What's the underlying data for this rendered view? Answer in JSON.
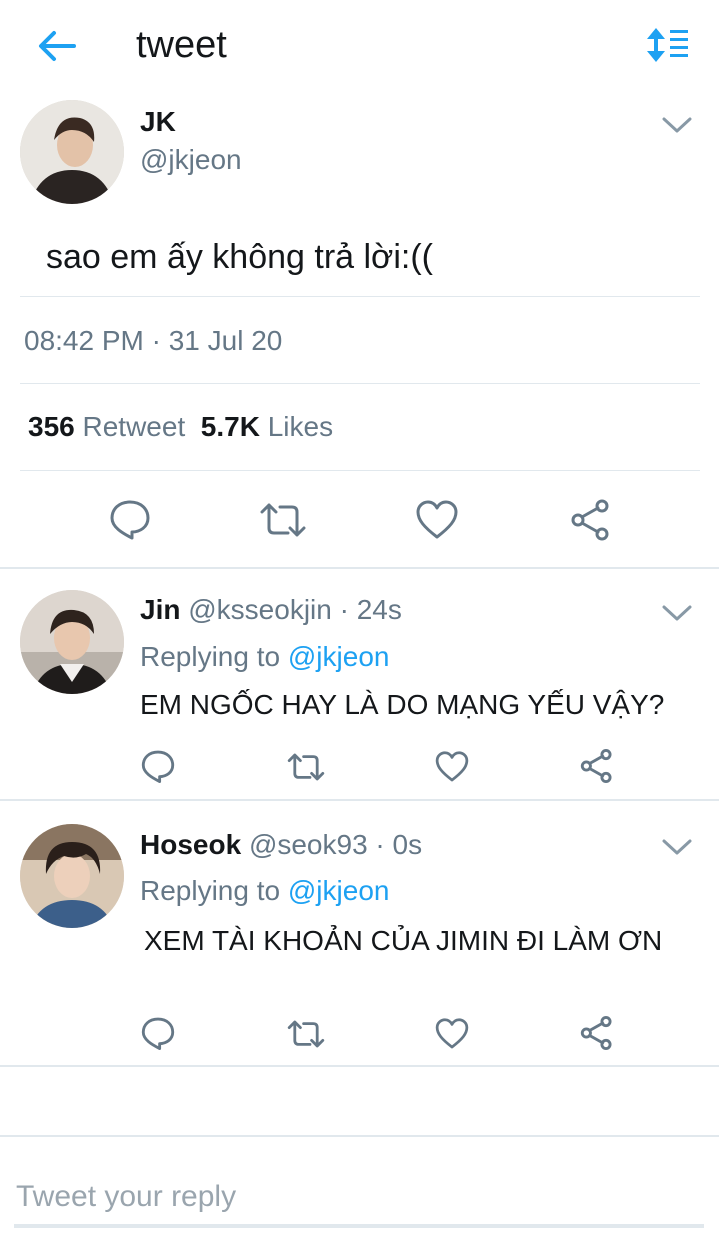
{
  "header": {
    "title": "tweet"
  },
  "tweet": {
    "name": "JK",
    "handle": "@jkjeon",
    "text": "sao em ấy không trả lời:((",
    "timestamp": "08:42 PM · 31 Jul 20",
    "retweet_count": "356",
    "retweet_label": "Retweet",
    "like_count": "5.7K",
    "like_label": "Likes"
  },
  "replies": [
    {
      "name": "Jin",
      "handle_time": "@ksseokjin · 24s",
      "replying_prefix": "Replying to",
      "replying_to": "@jkjeon",
      "text": "EM NGỐC HAY LÀ DO MẠNG YẾU VẬY?"
    },
    {
      "name": "Hoseok",
      "handle_time": "@seok93 · 0s",
      "replying_prefix": "Replying to",
      "replying_to": "@jkjeon",
      "text": "XEM TÀI KHOẢN CỦA JIMIN ĐI LÀM ƠN"
    }
  ],
  "composer": {
    "placeholder": "Tweet your reply"
  },
  "colors": {
    "accent": "#1da1f2",
    "secondary_text": "#657786",
    "divider": "#e1e8ed"
  },
  "icons": {
    "back": "arrow-left-icon",
    "sort": "sort-icon",
    "caret": "chevron-down-icon",
    "reply": "comment-icon",
    "retweet": "retweet-icon",
    "like": "heart-icon",
    "share": "share-icon"
  }
}
